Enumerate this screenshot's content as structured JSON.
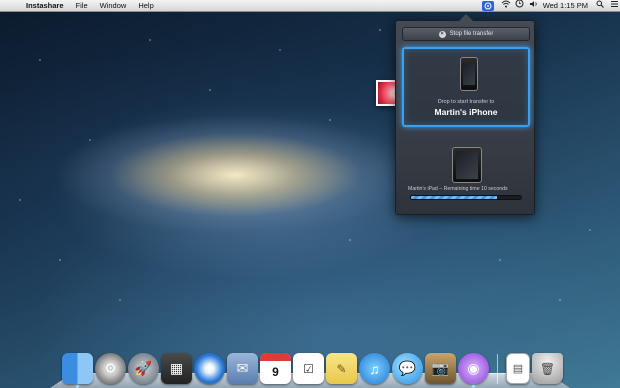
{
  "menubar": {
    "app_name": "Instashare",
    "menus": [
      "File",
      "Window",
      "Help"
    ],
    "clock": "Wed 1:15 PM",
    "status_icons": [
      "instashare-icon",
      "wifi-icon",
      "timemachine-icon",
      "volume-icon",
      "spotlight-icon",
      "list-icon"
    ]
  },
  "panel": {
    "stop_label": "Stop file transfer",
    "drop_text": "Drop to start transfer to",
    "device_name": "Martin's iPhone",
    "remaining_text": "Martin's iPad – Remaining time 10 seconds",
    "progress": 0.78
  },
  "dock": {
    "calendar_day": "9",
    "apps": [
      "finder",
      "system-preferences",
      "launchpad",
      "mission-control",
      "safari",
      "mail",
      "calendar",
      "reminders",
      "notes",
      "itunes",
      "messages",
      "iphoto",
      "instashare"
    ],
    "right_items": [
      "document",
      "trash"
    ]
  },
  "colors": {
    "accent": "#3ba0f0",
    "panel_bg": "#3a3f47"
  }
}
